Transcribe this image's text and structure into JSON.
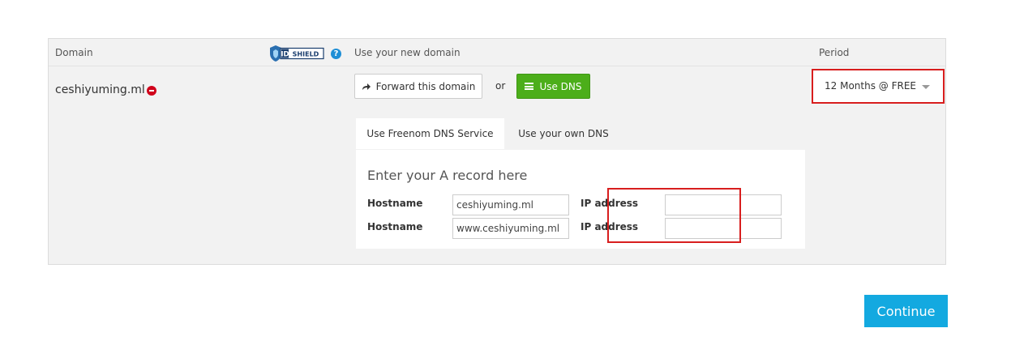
{
  "table": {
    "headers": {
      "domain": "Domain",
      "new_domain": "Use your new domain",
      "period": "Period"
    },
    "idshield_label": "IDSHIELD",
    "help_glyph": "?"
  },
  "row": {
    "domain_name": "ceshiyuming.ml",
    "forward_button": "Forward this domain",
    "or_text": "or",
    "use_dns_button": "Use DNS",
    "period_value": "12 Months @ FREE"
  },
  "dns": {
    "tabs": [
      {
        "label": "Use Freenom DNS Service",
        "active": true
      },
      {
        "label": "Use your own DNS",
        "active": false
      }
    ],
    "title": "Enter your A record here",
    "records": [
      {
        "hostname_label": "Hostname",
        "hostname_value": "ceshiyuming.ml",
        "ip_label": "IP address",
        "ip_value": ""
      },
      {
        "hostname_label": "Hostname",
        "hostname_value": "www.ceshiyuming.ml",
        "ip_label": "IP address",
        "ip_value": ""
      }
    ]
  },
  "footer": {
    "continue_button": "Continue"
  },
  "colors": {
    "accent_blue": "#13a9e0",
    "dns_green": "#4cae1a",
    "highlight_red": "#d81e1e",
    "remove_red": "#d0021b"
  },
  "icons": [
    "idshield-logo",
    "help-icon",
    "remove-icon",
    "forward-arrow-icon",
    "list-icon",
    "caret-down-icon"
  ]
}
